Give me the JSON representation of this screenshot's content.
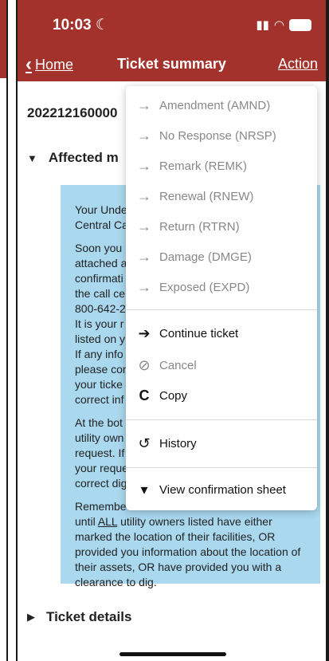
{
  "status": {
    "time": "10:03",
    "moon": "☾"
  },
  "nav": {
    "back": "Home",
    "title": "Ticket summary",
    "action": "Action"
  },
  "ticket": {
    "number": "202212160000"
  },
  "sections": {
    "affected": "Affected m",
    "details": "Ticket details"
  },
  "notice": {
    "p1": "Your Unde",
    "p1b": "Central Ca",
    "p2": [
      "Soon you",
      "attached a",
      "confirmati",
      "the call ce",
      "800-642-2",
      "It is your r",
      "listed on y",
      "If any info",
      "please con",
      "your ticke",
      "correct inf"
    ],
    "p3": [
      "At the bot",
      "utility own",
      "request. If",
      "your reque",
      "correct dig"
    ],
    "p4": [
      "Remembe",
      "until ALL utility owners listed have either",
      "marked the location of their facilities, OR",
      "provided you information about the location of",
      "their assets, OR have provided you with a",
      "clearance to dig."
    ]
  },
  "menu": {
    "group1": [
      {
        "label": "Amendment (AMND)",
        "icon": "arrow-right-icon"
      },
      {
        "label": "No Response (NRSP)",
        "icon": "arrow-right-icon"
      },
      {
        "label": "Remark (REMK)",
        "icon": "arrow-right-icon"
      },
      {
        "label": "Renewal (RNEW)",
        "icon": "arrow-right-icon"
      },
      {
        "label": "Return (RTRN)",
        "icon": "arrow-right-icon"
      },
      {
        "label": "Damage (DMGE)",
        "icon": "arrow-right-icon"
      },
      {
        "label": "Exposed (EXPD)",
        "icon": "arrow-right-icon"
      }
    ],
    "continue": "Continue ticket",
    "cancel": "Cancel",
    "copy": "Copy",
    "history": "History",
    "view": "View confirmation sheet"
  },
  "colors": {
    "brand": "#a4322c",
    "notice": "#a9d8ef"
  }
}
